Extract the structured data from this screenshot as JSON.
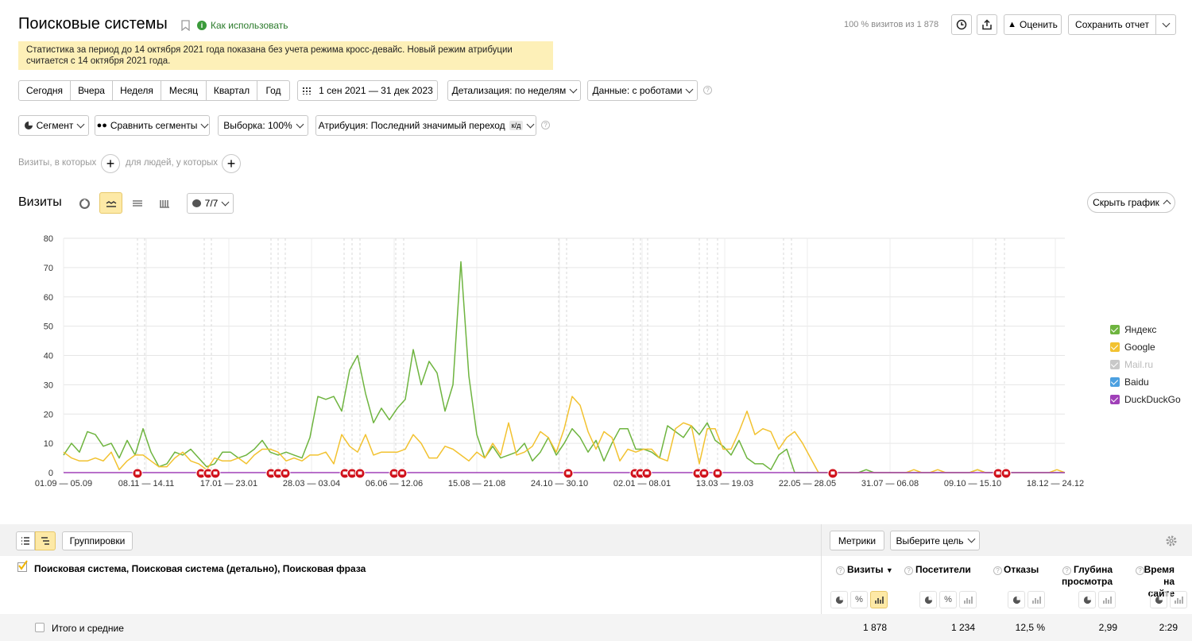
{
  "header": {
    "title": "Поисковые системы",
    "how_to": "Как использовать",
    "visits_note": "100 % визитов из 1 878",
    "rate_btn": "Оценить",
    "save_btn": "Сохранить отчет"
  },
  "notice": {
    "line1": "Статистика за период до 14 октября 2021 года показана без учета режима кросс-девайс. Новый режим атрибуции",
    "line2": "считается с 14 октября 2021 года."
  },
  "periods": [
    "Сегодня",
    "Вчера",
    "Неделя",
    "Месяц",
    "Квартал",
    "Год"
  ],
  "date_range": "1 сен 2021 — 31 дек 2023",
  "detail": "Детализация: по неделям",
  "data_mode": "Данные: с роботами",
  "filters": {
    "segment": "Сегмент",
    "compare": "Сравнить сегменты",
    "sample": "Выборка: 100%",
    "attribution": "Атрибуция: Последний значимый переход",
    "attribution_badge": "к/д"
  },
  "conditions": {
    "visits_label": "Визиты, в которых",
    "people_label": "для людей, у которых"
  },
  "chart_header": {
    "title": "Визиты",
    "series_counter": "7/7",
    "hide_btn": "Скрыть график"
  },
  "chart_data": {
    "type": "line",
    "ylim": [
      0,
      80
    ],
    "yticks": [
      "0",
      "10",
      "20",
      "30",
      "40",
      "50",
      "60",
      "70",
      "80"
    ],
    "xtick_labels": [
      "01.09 — 05.09",
      "08.11 — 14.11",
      "17.01 — 23.01",
      "28.03 — 03.04",
      "06.06 — 12.06",
      "15.08 — 21.08",
      "24.10 — 30.10",
      "02.01 — 08.01",
      "13.03 — 19.03",
      "22.05 — 28.05",
      "31.07 — 06.08",
      "09.10 — 15.10",
      "18.12 — 24.12"
    ],
    "series": [
      {
        "name": "Яндекс",
        "color": "#6eb43f",
        "values": [
          6,
          10,
          7,
          14,
          13,
          9,
          10,
          5,
          11,
          6,
          15,
          7,
          2,
          3,
          7,
          6,
          8,
          5,
          2,
          3,
          7,
          7,
          5,
          6,
          8,
          11,
          7,
          6,
          7,
          6,
          5,
          12,
          26,
          25,
          26,
          21,
          35,
          40,
          27,
          17,
          22,
          18,
          22,
          25,
          42,
          30,
          38,
          34,
          21,
          30,
          72,
          33,
          13,
          5,
          9,
          5,
          6,
          7,
          10,
          4,
          7,
          12,
          6,
          10,
          15,
          12,
          7,
          11,
          4,
          10,
          15,
          15,
          8,
          8,
          7,
          5,
          16,
          14,
          12,
          16,
          13,
          17,
          11,
          9,
          6,
          11,
          5,
          3,
          3,
          1,
          6,
          8,
          0,
          0,
          0,
          0,
          0,
          0,
          0,
          0,
          0,
          1,
          0,
          0,
          0,
          0,
          0,
          0,
          0,
          0,
          0,
          0,
          0,
          0,
          0,
          1,
          0,
          0,
          0,
          0,
          0,
          0,
          0,
          0,
          0,
          0,
          0
        ]
      },
      {
        "name": "Google",
        "color": "#f2c230",
        "values": [
          7,
          5,
          4,
          4,
          5,
          4,
          7,
          1,
          4,
          6,
          6,
          4,
          2,
          2,
          5,
          7,
          4,
          3,
          1,
          5,
          4,
          4,
          5,
          3,
          6,
          8,
          8,
          7,
          4,
          5,
          4,
          6,
          6,
          7,
          3,
          13,
          9,
          7,
          13,
          6,
          7,
          7,
          7,
          8,
          13,
          10,
          5,
          5,
          9,
          8,
          6,
          4,
          7,
          5,
          10,
          6,
          17,
          6,
          7,
          9,
          14,
          12,
          7,
          15,
          26,
          23,
          14,
          8,
          14,
          12,
          4,
          8,
          7,
          8,
          8,
          5,
          4,
          15,
          17,
          16,
          3,
          15,
          15,
          8,
          8,
          14,
          21,
          13,
          15,
          14,
          8,
          12,
          14,
          10,
          5,
          0,
          0,
          0,
          0,
          0,
          0,
          0,
          0,
          0,
          0,
          0,
          0,
          1,
          0,
          0,
          1,
          0,
          0,
          0,
          0,
          1,
          0,
          0,
          0,
          0,
          0,
          0,
          0,
          0,
          0,
          1,
          0
        ]
      },
      {
        "name": "Mail.ru",
        "color": "#c8c8c8",
        "values": []
      },
      {
        "name": "Baidu",
        "color": "#4ca0e0",
        "values": []
      },
      {
        "name": "DuckDuckGo",
        "color": "#a040b8",
        "values": []
      }
    ],
    "legend_position": "right",
    "grid": true
  },
  "toolbar": {
    "groupings": "Группировки",
    "metrics": "Метрики",
    "goal": "Выберите цель"
  },
  "table": {
    "group_header": "Поисковая система, Поисковая система (детально), Поисковая фраза",
    "columns": [
      "Визиты",
      "Посетители",
      "Отказы",
      "Глубина просмотра",
      "Время на сайте"
    ],
    "total_label": "Итого и средние",
    "totals": [
      "1 878",
      "1 234",
      "12,5 %",
      "2,99",
      "2:29"
    ]
  }
}
